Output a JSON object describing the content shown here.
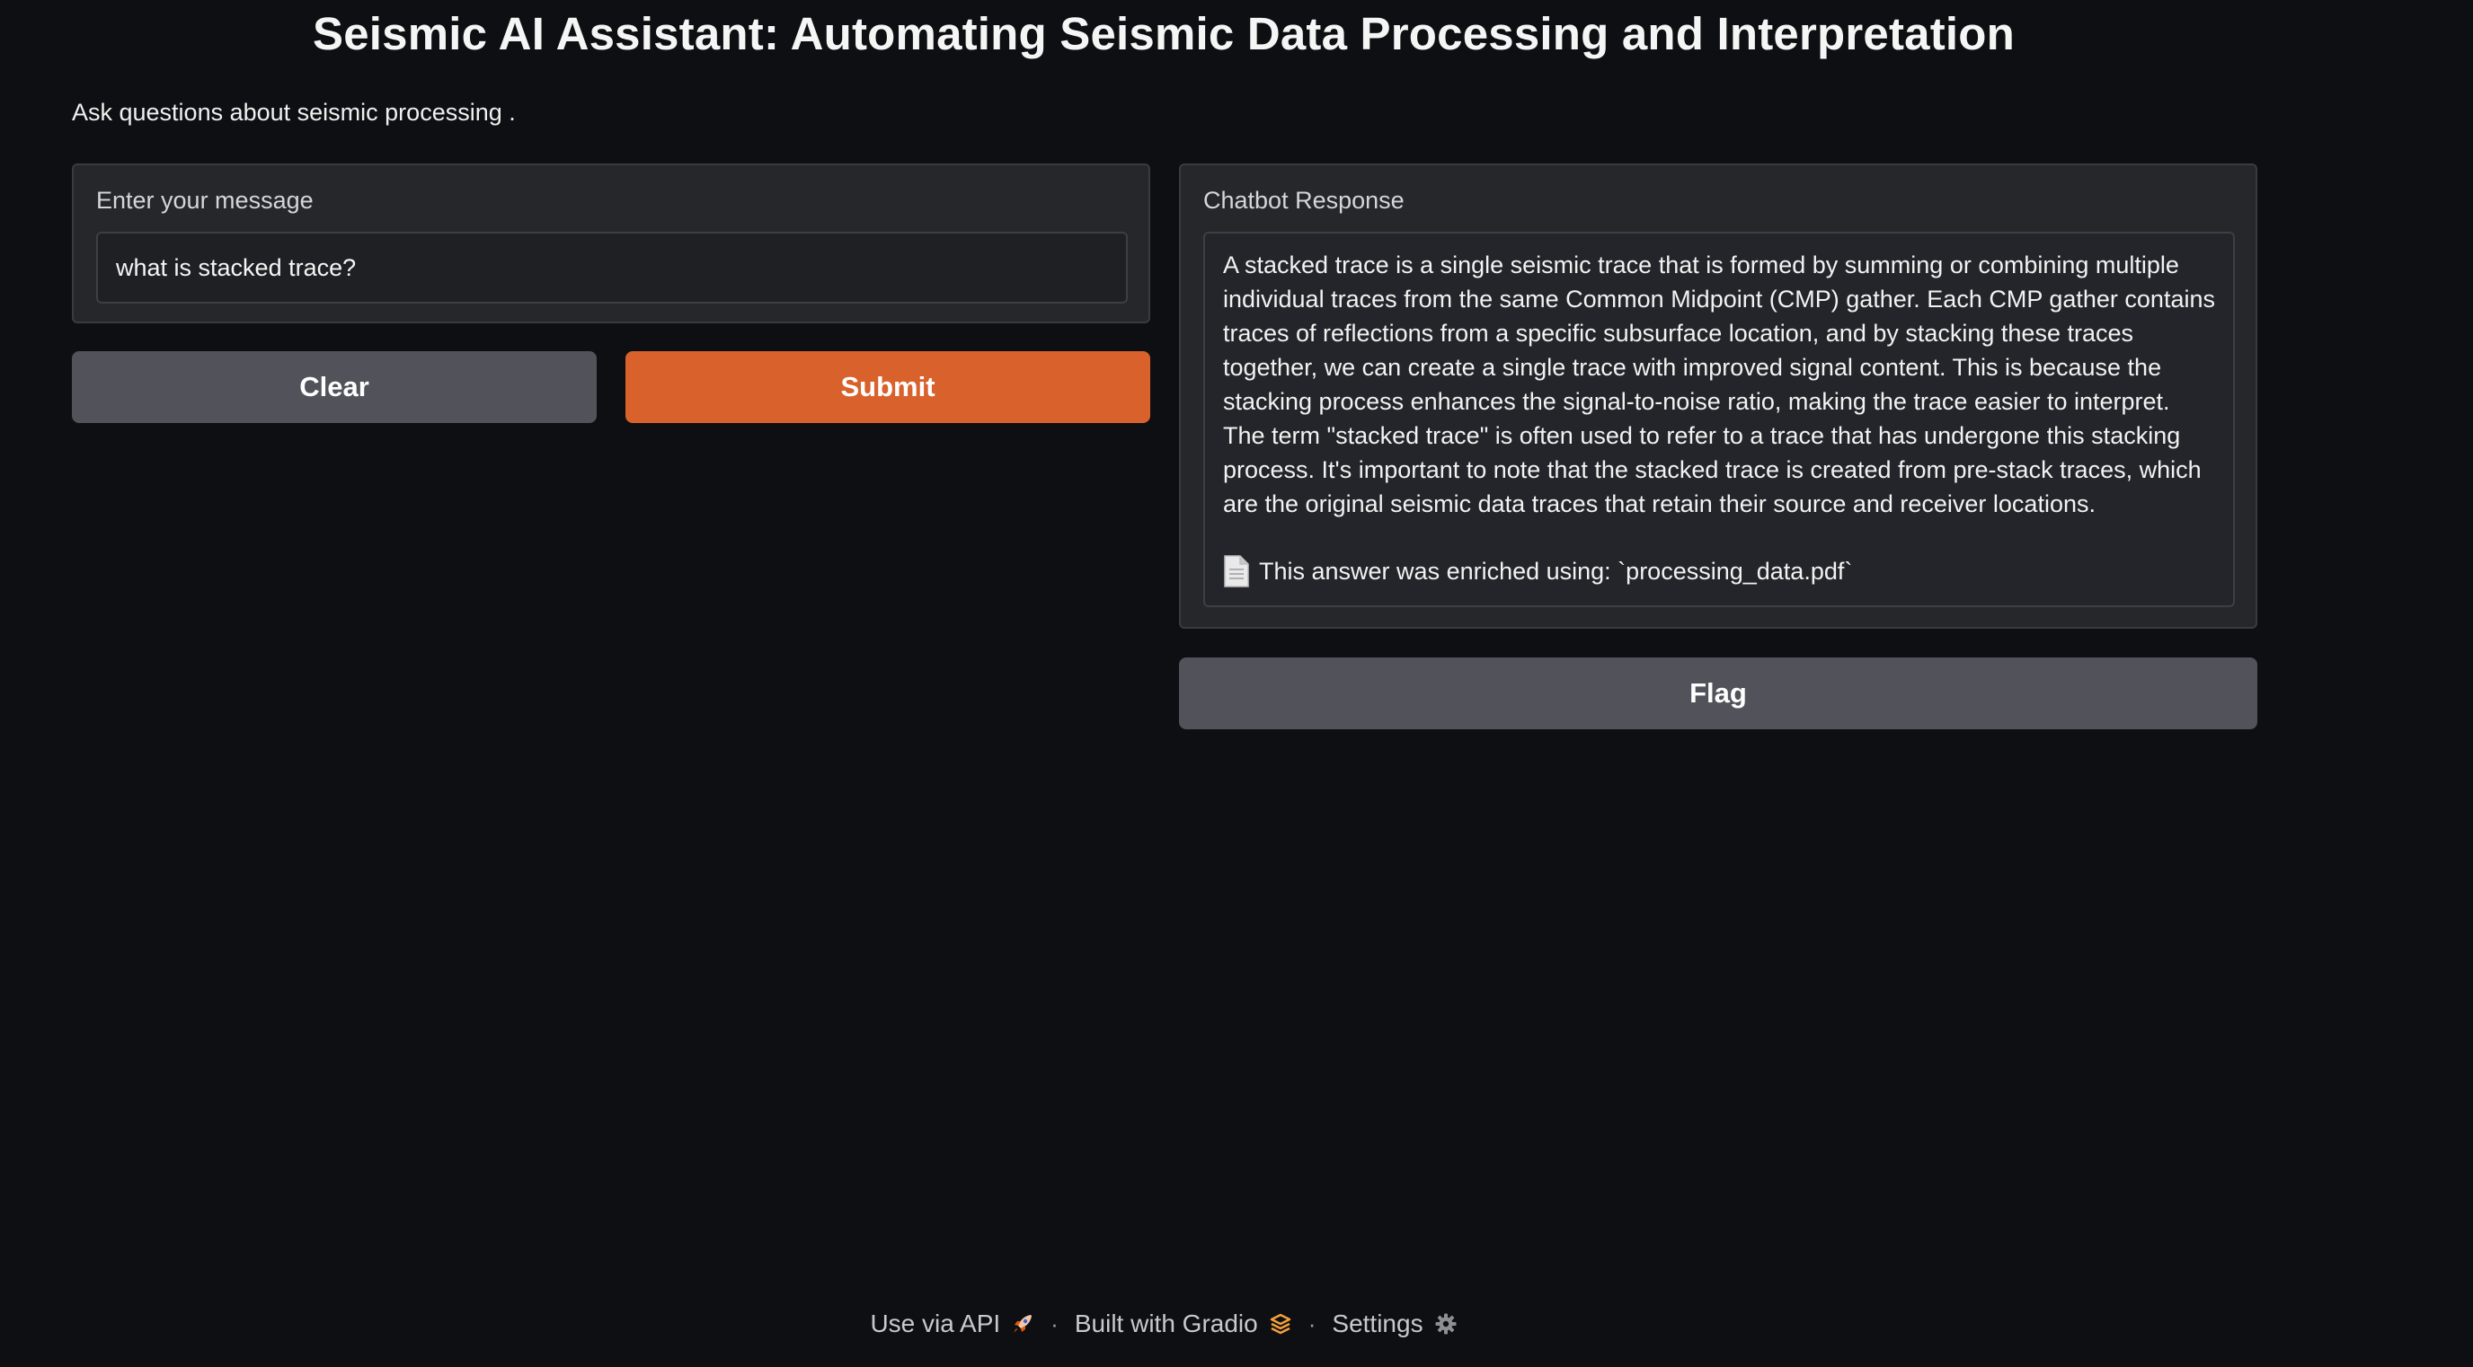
{
  "header": {
    "title": "Seismic AI Assistant: Automating Seismic Data Processing and Interpretation",
    "description": "Ask questions about seismic processing ."
  },
  "input": {
    "label": "Enter your message",
    "value": "what is stacked trace?"
  },
  "buttons": {
    "clear_label": "Clear",
    "submit_label": "Submit",
    "flag_label": "Flag"
  },
  "response": {
    "label": "Chatbot Response",
    "text": "A stacked trace is a single seismic trace that is formed by summing or combining multiple individual traces from the same Common Midpoint (CMP) gather. Each CMP gather contains traces of reflections from a specific subsurface location, and by stacking these traces together, we can create a single trace with improved signal content. This is because the stacking process enhances the signal-to-noise ratio, making the trace easier to interpret. The term \"stacked trace\" is often used to refer to a trace that has undergone this stacking process. It's important to note that the stacked trace is created from pre-stack traces, which are the original seismic data traces that retain their source and receiver locations.",
    "enriched_note": "This answer was enriched using: `processing_data.pdf`",
    "enriched_icon": "document-icon"
  },
  "footer": {
    "api_label": "Use via API",
    "api_icon": "rocket-icon",
    "built_label": "Built with Gradio",
    "built_icon": "gradio-logo-icon",
    "settings_label": "Settings",
    "settings_icon": "gear-icon",
    "separator": "·"
  },
  "colors": {
    "background": "#0e0f12",
    "panel": "#26272b",
    "submit_accent": "#d9612b",
    "secondary_button": "#52535a",
    "gradio_orange": "#f4a03c"
  }
}
